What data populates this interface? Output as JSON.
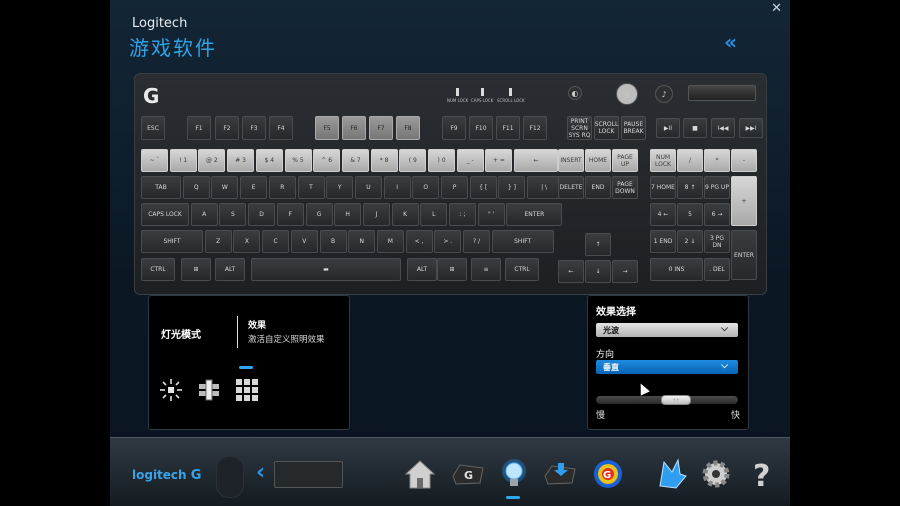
{
  "window": {
    "brand": "Logitech",
    "title": "游戏软件",
    "close_glyph": "✕",
    "collapse_glyph": "«"
  },
  "keyboard": {
    "logo": "G",
    "indicators": [
      "NUM LOCK",
      "CAPS LOCK",
      "SCROLL LOCK"
    ],
    "fn_row": [
      "ESC",
      "F1",
      "F2",
      "F3",
      "F4",
      "F5",
      "F6",
      "F7",
      "F8",
      "F9",
      "F10",
      "F11",
      "F12",
      "PRINT SCRN SYS RQ",
      "SCROLL LOCK",
      "PAUSE BREAK"
    ],
    "num_row": [
      "~ `",
      "! 1",
      "@ 2",
      "# 3",
      "$ 4",
      "% 5",
      "^ 6",
      "& 7",
      "* 8",
      "( 9",
      ") 0",
      "_ -",
      "+ ="
    ],
    "qwerty_row": [
      "TAB",
      "Q",
      "W",
      "E",
      "R",
      "T",
      "Y",
      "U",
      "I",
      "O",
      "P",
      "{ [",
      "} ]",
      "| \\"
    ],
    "home_row": [
      "CAPS LOCK",
      "A",
      "S",
      "D",
      "F",
      "G",
      "H",
      "J",
      "K",
      "L",
      ": ;",
      "\" '",
      "ENTER"
    ],
    "shift_row": [
      "SHIFT",
      "Z",
      "X",
      "C",
      "V",
      "B",
      "N",
      "M",
      "< ,",
      "> .",
      "? /",
      "SHIFT"
    ],
    "bottom_row": [
      "CTRL",
      "⊞",
      "ALT",
      "ALT",
      "⊞",
      "≡",
      "CTRL"
    ],
    "nav_cluster": [
      "INSERT",
      "HOME",
      "PAGE UP",
      "DELETE",
      "END",
      "PAGE DOWN"
    ],
    "arrows": [
      "↑",
      "←",
      "↓",
      "→"
    ],
    "numpad": [
      "NUM LOCK",
      "/",
      "*",
      "-",
      "7 HOME",
      "8 ↑",
      "9 PG UP",
      "+",
      "4 ←",
      "5",
      "6 →",
      "1 END",
      "2 ↓",
      "3 PG DN",
      "ENTER",
      "0 INS",
      ". DEL"
    ],
    "media": [
      "▶II",
      "■",
      "I◀◀",
      "▶▶I"
    ],
    "colors": {
      "lit": "#cccccc",
      "dark": "#2e3134"
    }
  },
  "mode_panel": {
    "title": "灯光模式",
    "effect_title": "效果",
    "effect_desc": "激活自定义照明效果",
    "icons": [
      "burst-icon",
      "slider-mode-icon",
      "grid-mode-icon"
    ],
    "active_index": 2
  },
  "effect_panel": {
    "title": "效果选择",
    "effect_value": "光波",
    "direction_label": "方向",
    "direction_value": "垂直",
    "speed_slow": "慢",
    "speed_fast": "快",
    "speed_level": 0.58
  },
  "bottom_bar": {
    "logo": "logitech",
    "nav_icons": [
      "home-icon",
      "g-key-icon",
      "lighting-icon",
      "key-assign-icon",
      "heatmap-icon",
      "spectrum-icon",
      "settings-icon",
      "help-icon"
    ],
    "active_nav": "lighting-icon",
    "accent": "#2fa7f0"
  }
}
